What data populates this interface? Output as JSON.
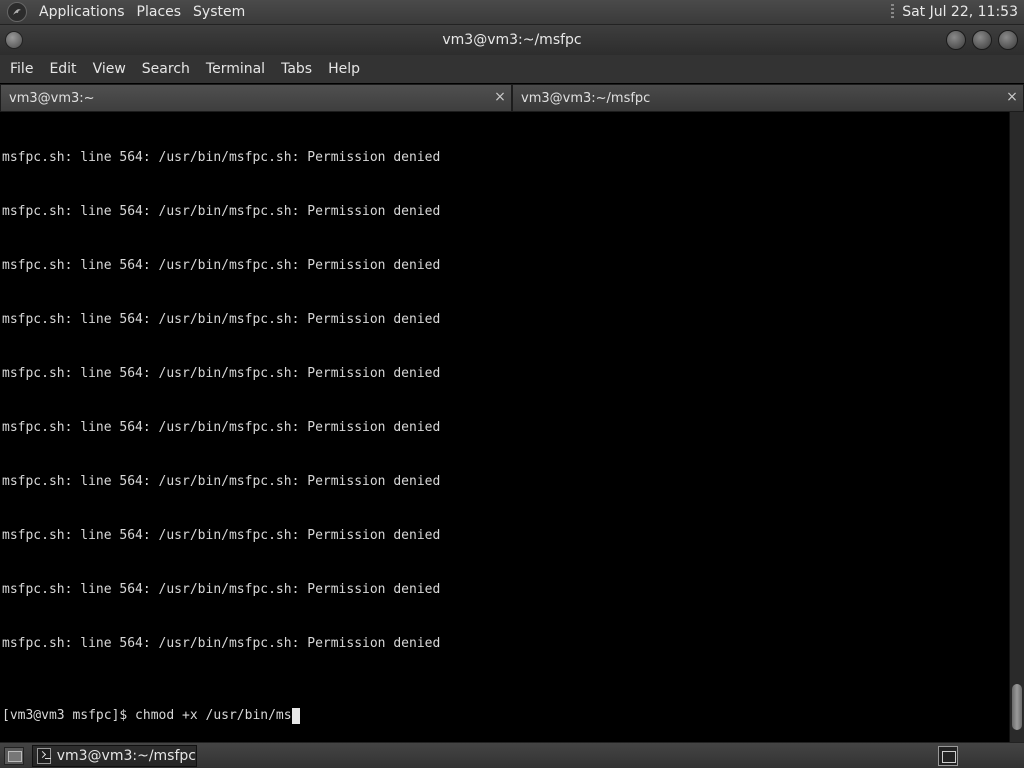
{
  "top_panel": {
    "menus": [
      "Applications",
      "Places",
      "System"
    ],
    "clock": "Sat Jul 22, 11:53"
  },
  "window": {
    "title": "vm3@vm3:~/msfpc"
  },
  "menubar": {
    "items": [
      "File",
      "Edit",
      "View",
      "Search",
      "Terminal",
      "Tabs",
      "Help"
    ]
  },
  "tabs": [
    {
      "label": "vm3@vm3:~",
      "active": false,
      "close": "×"
    },
    {
      "label": "vm3@vm3:~/msfpc",
      "active": true,
      "close": "×"
    }
  ],
  "terminal": {
    "lines": [
      "msfpc.sh: line 564: /usr/bin/msfpc.sh: Permission denied",
      "msfpc.sh: line 564: /usr/bin/msfpc.sh: Permission denied",
      "msfpc.sh: line 564: /usr/bin/msfpc.sh: Permission denied",
      "msfpc.sh: line 564: /usr/bin/msfpc.sh: Permission denied",
      "msfpc.sh: line 564: /usr/bin/msfpc.sh: Permission denied",
      "msfpc.sh: line 564: /usr/bin/msfpc.sh: Permission denied",
      "msfpc.sh: line 564: /usr/bin/msfpc.sh: Permission denied",
      "msfpc.sh: line 564: /usr/bin/msfpc.sh: Permission denied",
      "msfpc.sh: line 564: /usr/bin/msfpc.sh: Permission denied",
      "msfpc.sh: line 564: /usr/bin/msfpc.sh: Permission denied"
    ],
    "prompt": "[vm3@vm3 msfpc]$ chmod +x /usr/bin/ms"
  },
  "taskbar": {
    "task_label": "vm3@vm3:~/msfpc"
  },
  "icons": {
    "app_logo": "kali-dragon-icon",
    "tab_close": "close-icon",
    "task": "terminal-icon",
    "workspace": "workspace-switcher-icon",
    "show_desktop": "show-desktop-icon"
  }
}
